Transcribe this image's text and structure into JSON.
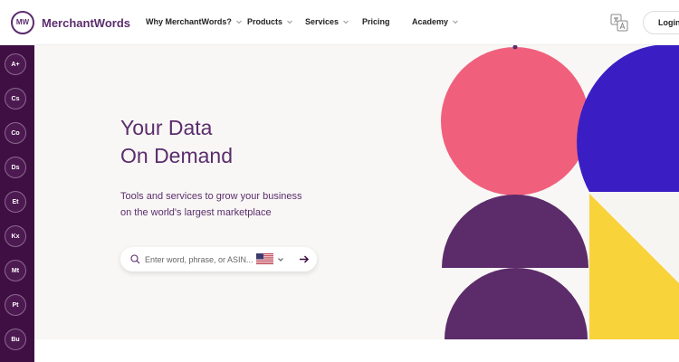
{
  "header": {
    "logo_mark": "MW",
    "logo_text": "MerchantWords",
    "nav": [
      {
        "label": "Why MerchantWords?",
        "has_caret": true
      },
      {
        "label": "Products",
        "has_caret": true
      },
      {
        "label": "Services",
        "has_caret": true
      },
      {
        "label": "Pricing",
        "has_caret": false
      },
      {
        "label": "Academy",
        "has_caret": true
      }
    ],
    "login_label": "Login"
  },
  "sidebar": {
    "items": [
      "A+",
      "Cs",
      "Co",
      "Ds",
      "Et",
      "Kx",
      "Mt",
      "Pt",
      "Bu"
    ]
  },
  "hero": {
    "headline_line1": "Your Data",
    "headline_line2": "On Demand",
    "subtext_line1": "Tools and services to grow your business",
    "subtext_line2": "on the world's largest marketplace"
  },
  "search": {
    "placeholder": "Enter word, phrase, or ASIN...",
    "marketplace_flag": "us-flag-icon"
  },
  "colors": {
    "brand_purple": "#5b2d6d",
    "sidebar_bg": "#3f0f43",
    "hero_bg": "#f8f7f5",
    "shape_pink": "#f0607d",
    "shape_purple": "#5c2b6a",
    "shape_blue": "#3a1ec4",
    "shape_yellow": "#f8d33a"
  }
}
